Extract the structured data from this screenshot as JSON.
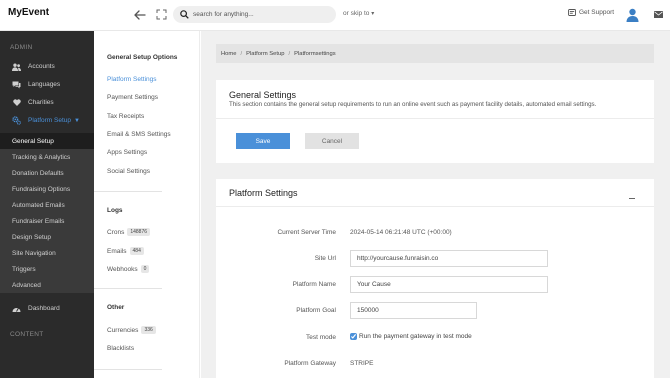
{
  "app": {
    "logo": "MyEvent"
  },
  "topbar": {
    "search_placeholder": "search for anything...",
    "skip_label": "or skip to",
    "support_label": "Get Support"
  },
  "sidebar": {
    "admin_label": "ADMIN",
    "content_label": "CONTENT",
    "items": [
      {
        "label": "Accounts",
        "icon": "users-icon"
      },
      {
        "label": "Languages",
        "icon": "chat-icon"
      },
      {
        "label": "Charities",
        "icon": "heart-icon"
      },
      {
        "label": "Platform Setup",
        "icon": "gears-icon"
      }
    ],
    "subitems": [
      {
        "label": "General Setup"
      },
      {
        "label": "Tracking & Analytics"
      },
      {
        "label": "Donation Defaults"
      },
      {
        "label": "Fundraising Options"
      },
      {
        "label": "Automated Emails"
      },
      {
        "label": "Fundraiser Emails"
      },
      {
        "label": "Design Setup"
      },
      {
        "label": "Site Navigation"
      },
      {
        "label": "Triggers"
      },
      {
        "label": "Advanced"
      }
    ],
    "dashboard_label": "Dashboard"
  },
  "midpanel": {
    "general_heading": "General Setup Options",
    "general_links": [
      {
        "label": "Platform Settings"
      },
      {
        "label": "Payment Settings"
      },
      {
        "label": "Tax Receipts"
      },
      {
        "label": "Email & SMS Settings"
      },
      {
        "label": "Apps Settings"
      },
      {
        "label": "Social Settings"
      }
    ],
    "logs_heading": "Logs",
    "logs_links": [
      {
        "label": "Crons",
        "count": "148876"
      },
      {
        "label": "Emails",
        "count": "484"
      },
      {
        "label": "Webhooks",
        "count": "0"
      }
    ],
    "other_heading": "Other",
    "other_links": [
      {
        "label": "Currencies",
        "count": "336"
      },
      {
        "label": "Blacklists"
      }
    ]
  },
  "breadcrumb": [
    "Home",
    "Platform Setup",
    "Platformsettings"
  ],
  "general_card": {
    "title": "General Settings",
    "description": "This section contains the general setup requirements to run an online event such as payment facility details, automated email settings.",
    "save_label": "Save",
    "cancel_label": "Cancel"
  },
  "platform_card": {
    "title": "Platform Settings",
    "fields": {
      "server_time_label": "Current Server Time",
      "server_time_value": "2024-05-14 06:21:48 UTC (+00:00)",
      "site_url_label": "Site Url",
      "site_url_value": "http://yourcause.funraisin.co",
      "platform_name_label": "Platform Name",
      "platform_name_value": "Your Cause",
      "platform_goal_label": "Platform Goal",
      "platform_goal_value": "150000",
      "test_mode_label": "Test mode",
      "test_mode_text": "Run the payment gateway in test mode",
      "test_mode_checked": true,
      "gateway_label": "Platform Gateway",
      "gateway_value": "STRIPE"
    }
  },
  "colors": {
    "accent": "#4a90d9",
    "sidebar_bg": "#2b2b2b"
  }
}
